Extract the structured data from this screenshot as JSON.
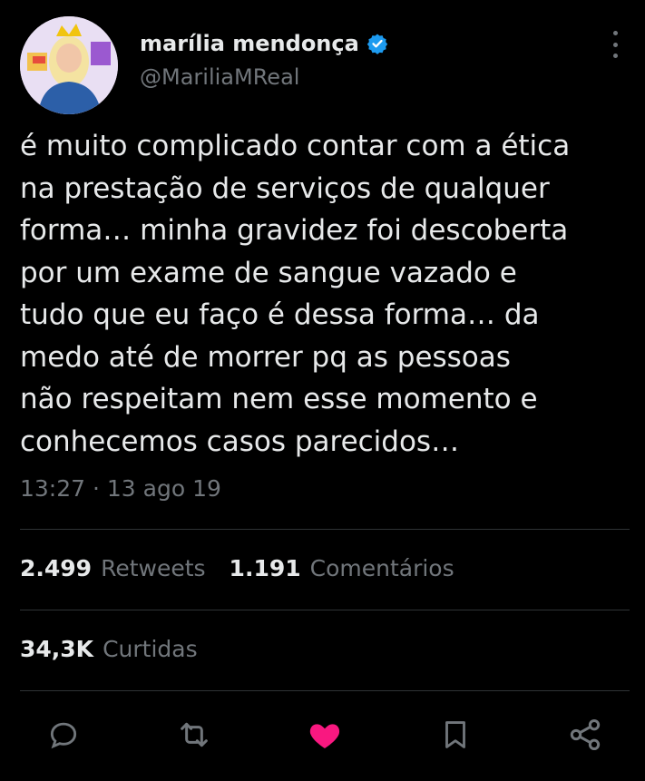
{
  "author": {
    "display_name": "marília mendonça",
    "handle": "@MariliaMReal",
    "verified": true
  },
  "tweet": {
    "text": "é muito complicado contar com a ética\nna prestação de serviços de qualquer\nforma… minha gravidez foi descoberta\npor um exame de sangue vazado e\ntudo que eu faço é dessa forma… da\nmedo até de morrer pq as pessoas\nnão respeitam nem esse momento e\nconhecemos casos parecidos…",
    "timestamp": "13:27 · 13 ago 19"
  },
  "stats": {
    "retweets_count": "2.499",
    "retweets_label": "Retweets",
    "comments_count": "1.191",
    "comments_label": "Comentários",
    "likes_count": "34,3K",
    "likes_label": "Curtidas"
  },
  "actions": [
    "reply-icon",
    "retweet-icon",
    "like-icon",
    "bookmark-icon",
    "share-icon"
  ],
  "colors": {
    "background": "#000000",
    "text": "#e7e9ea",
    "muted": "#71767b",
    "divider": "#2f3336",
    "verified": "#1d9bf0",
    "liked": "#f91880"
  }
}
